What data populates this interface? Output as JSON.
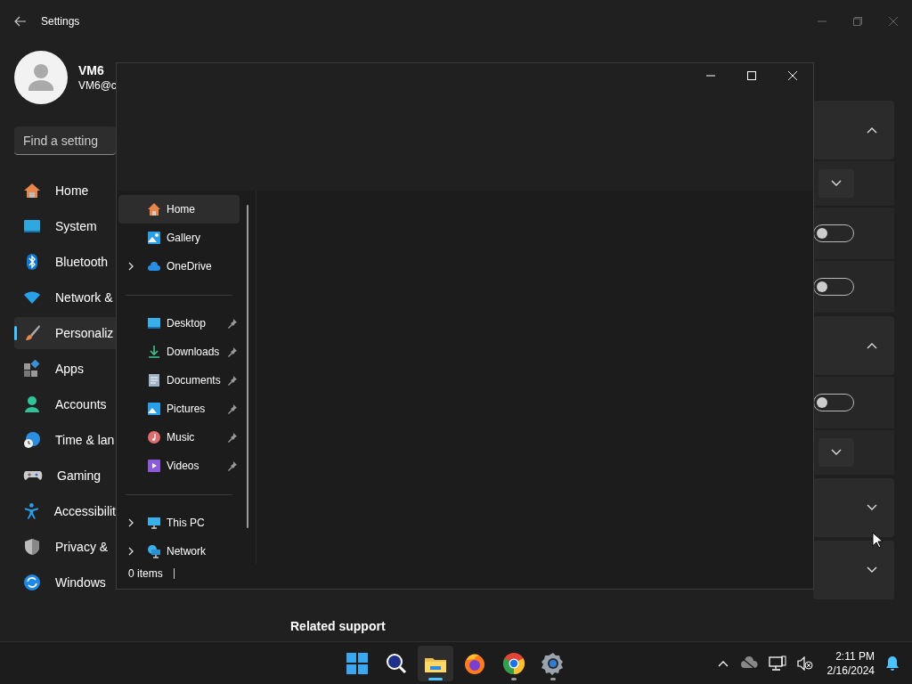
{
  "settings": {
    "title": "Settings",
    "user": {
      "name": "VM6",
      "email": "VM6@c"
    },
    "search": {
      "placeholder": "Find a setting"
    },
    "nav": [
      {
        "label": "Home",
        "selected": false
      },
      {
        "label": "System",
        "selected": false
      },
      {
        "label": "Bluetooth",
        "selected": false
      },
      {
        "label": "Network &",
        "selected": false
      },
      {
        "label": "Personaliz",
        "selected": true
      },
      {
        "label": "Apps",
        "selected": false
      },
      {
        "label": "Accounts",
        "selected": false
      },
      {
        "label": "Time & lan",
        "selected": false
      },
      {
        "label": "Gaming",
        "selected": false
      },
      {
        "label": "Accessibilit",
        "selected": false
      },
      {
        "label": "Privacy &",
        "selected": false
      },
      {
        "label": "Windows",
        "selected": false
      }
    ],
    "sections": [
      {
        "expanded": true,
        "rows": [
          {
            "kind": "dropdown"
          },
          {
            "kind": "toggle",
            "on": false
          },
          {
            "kind": "toggle",
            "on": false
          }
        ]
      },
      {
        "expanded": true,
        "rows": [
          {
            "kind": "toggle",
            "on": false
          },
          {
            "kind": "dropdown"
          }
        ]
      },
      {
        "expanded": false
      },
      {
        "expanded": false
      }
    ],
    "footer_heading": "Related support"
  },
  "explorer": {
    "groups": [
      {
        "items": [
          {
            "label": "Home",
            "selected": true,
            "expandable": false,
            "pinned": false
          },
          {
            "label": "Gallery",
            "selected": false,
            "expandable": false,
            "pinned": false
          },
          {
            "label": "OneDrive",
            "selected": false,
            "expandable": true,
            "pinned": false
          }
        ]
      },
      {
        "items": [
          {
            "label": "Desktop",
            "selected": false,
            "expandable": false,
            "pinned": true
          },
          {
            "label": "Downloads",
            "selected": false,
            "expandable": false,
            "pinned": true
          },
          {
            "label": "Documents",
            "selected": false,
            "expandable": false,
            "pinned": true
          },
          {
            "label": "Pictures",
            "selected": false,
            "expandable": false,
            "pinned": true
          },
          {
            "label": "Music",
            "selected": false,
            "expandable": false,
            "pinned": true
          },
          {
            "label": "Videos",
            "selected": false,
            "expandable": false,
            "pinned": true
          }
        ]
      },
      {
        "items": [
          {
            "label": "This PC",
            "selected": false,
            "expandable": true,
            "pinned": false
          },
          {
            "label": "Network",
            "selected": false,
            "expandable": true,
            "pinned": false
          }
        ]
      }
    ],
    "status": "0 items"
  },
  "taskbar": {
    "apps": [
      {
        "selected": true,
        "running": true
      },
      {
        "selected": false,
        "running": false
      },
      {
        "selected": false,
        "running": true
      },
      {
        "selected": false,
        "running": true
      }
    ],
    "time": "2:11 PM",
    "date": "2/16/2024"
  }
}
